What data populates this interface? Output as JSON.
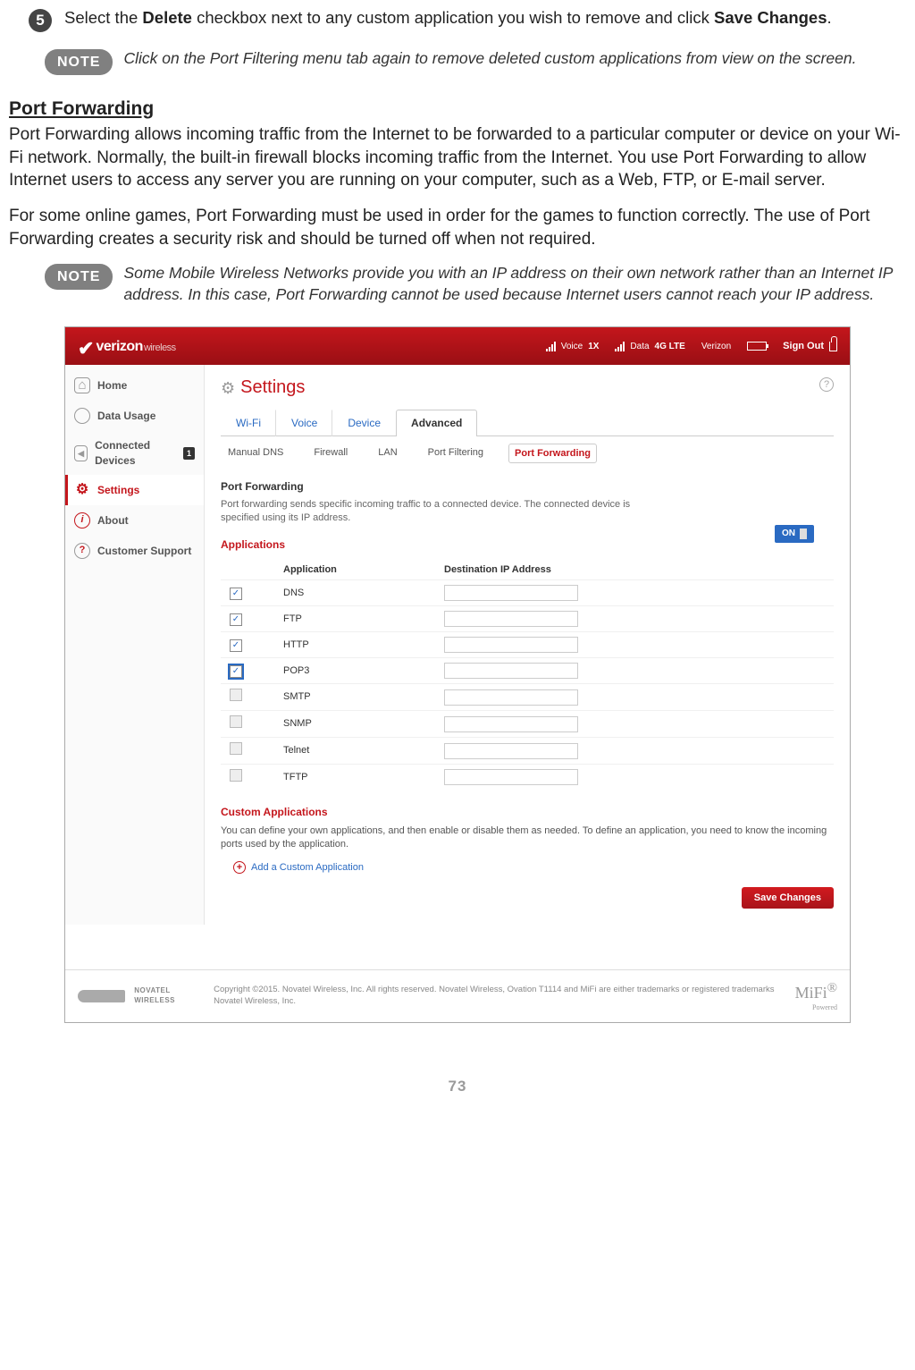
{
  "step": {
    "num": "➎",
    "text_a": "Select the ",
    "bold_a": "Delete",
    "text_b": " checkbox next to any custom application you wish to remove and click ",
    "bold_b": "Save Changes",
    "text_c": "."
  },
  "note1": {
    "label": "NOTE",
    "text": "Click on the Port Filtering menu tab again to remove deleted custom applications from view on the screen."
  },
  "pf_heading": "Port Forwarding",
  "pf_p1": "Port Forwarding allows incoming traffic from the Internet to be forwarded to a particular computer or device on your Wi-Fi network. Normally, the built-in firewall blocks incoming traffic from the Internet. You use Port Forwarding to allow Internet users to access any server you are running on your computer, such as a Web, FTP, or E-mail server.",
  "pf_p2": "For some online games, Port Forwarding must be used in order for the games to function correctly. The use of Port Forwarding creates a security risk and should be turned off when not required.",
  "note2": {
    "label": "NOTE",
    "text": "Some Mobile Wireless Networks provide you with an IP address on their own network rather than an Internet IP address. In this case, Port Forwarding cannot be used because Internet users cannot reach your IP address."
  },
  "screenshot": {
    "brand_a": "verizon",
    "brand_b": "wireless",
    "hdr_voice": "Voice",
    "hdr_voice_val": "1X",
    "hdr_data": "Data",
    "hdr_data_val": "4G LTE",
    "hdr_carrier": "Verizon",
    "hdr_signout": "Sign Out",
    "side": {
      "home": "Home",
      "data": "Data Usage",
      "conn": "Connected Devices",
      "conn_count": "1",
      "settings": "Settings",
      "about": "About",
      "support": "Customer Support"
    },
    "page_title": "Settings",
    "tabs": {
      "wifi": "Wi-Fi",
      "voice": "Voice",
      "device": "Device",
      "advanced": "Advanced"
    },
    "subtabs": {
      "dns": "Manual DNS",
      "fw": "Firewall",
      "lan": "LAN",
      "pfilt": "Port Filtering",
      "pfwd": "Port Forwarding"
    },
    "pf_section_title": "Port Forwarding",
    "pf_section_desc": "Port forwarding sends specific incoming traffic to a connected device. The connected device is specified using its IP address.",
    "toggle_on": "ON",
    "apps_heading": "Applications",
    "col_app": "Application",
    "col_ip": "Destination IP Address",
    "apps": [
      {
        "name": "DNS",
        "checked": true,
        "hl": false
      },
      {
        "name": "FTP",
        "checked": true,
        "hl": false
      },
      {
        "name": "HTTP",
        "checked": true,
        "hl": false
      },
      {
        "name": "POP3",
        "checked": true,
        "hl": true
      },
      {
        "name": "SMTP",
        "checked": false,
        "hl": false
      },
      {
        "name": "SNMP",
        "checked": false,
        "hl": false
      },
      {
        "name": "Telnet",
        "checked": false,
        "hl": false
      },
      {
        "name": "TFTP",
        "checked": false,
        "hl": false
      }
    ],
    "custom_heading": "Custom Applications",
    "custom_desc": "You can define your own applications, and then enable or disable them as needed. To define an application, you need to know the incoming ports used by the application.",
    "add_link": "Add a Custom Application",
    "save_btn": "Save Changes",
    "footer_brand": "NOVATEL WIRELESS",
    "footer_copy": "Copyright ©2015. Novatel Wireless, Inc. All rights reserved. Novatel Wireless, Ovation T1114 and MiFi are either trademarks or registered trademarks Novatel Wireless, Inc.",
    "mifi": "MiFi",
    "mifi_sub": "Powered"
  },
  "page_number": "73"
}
